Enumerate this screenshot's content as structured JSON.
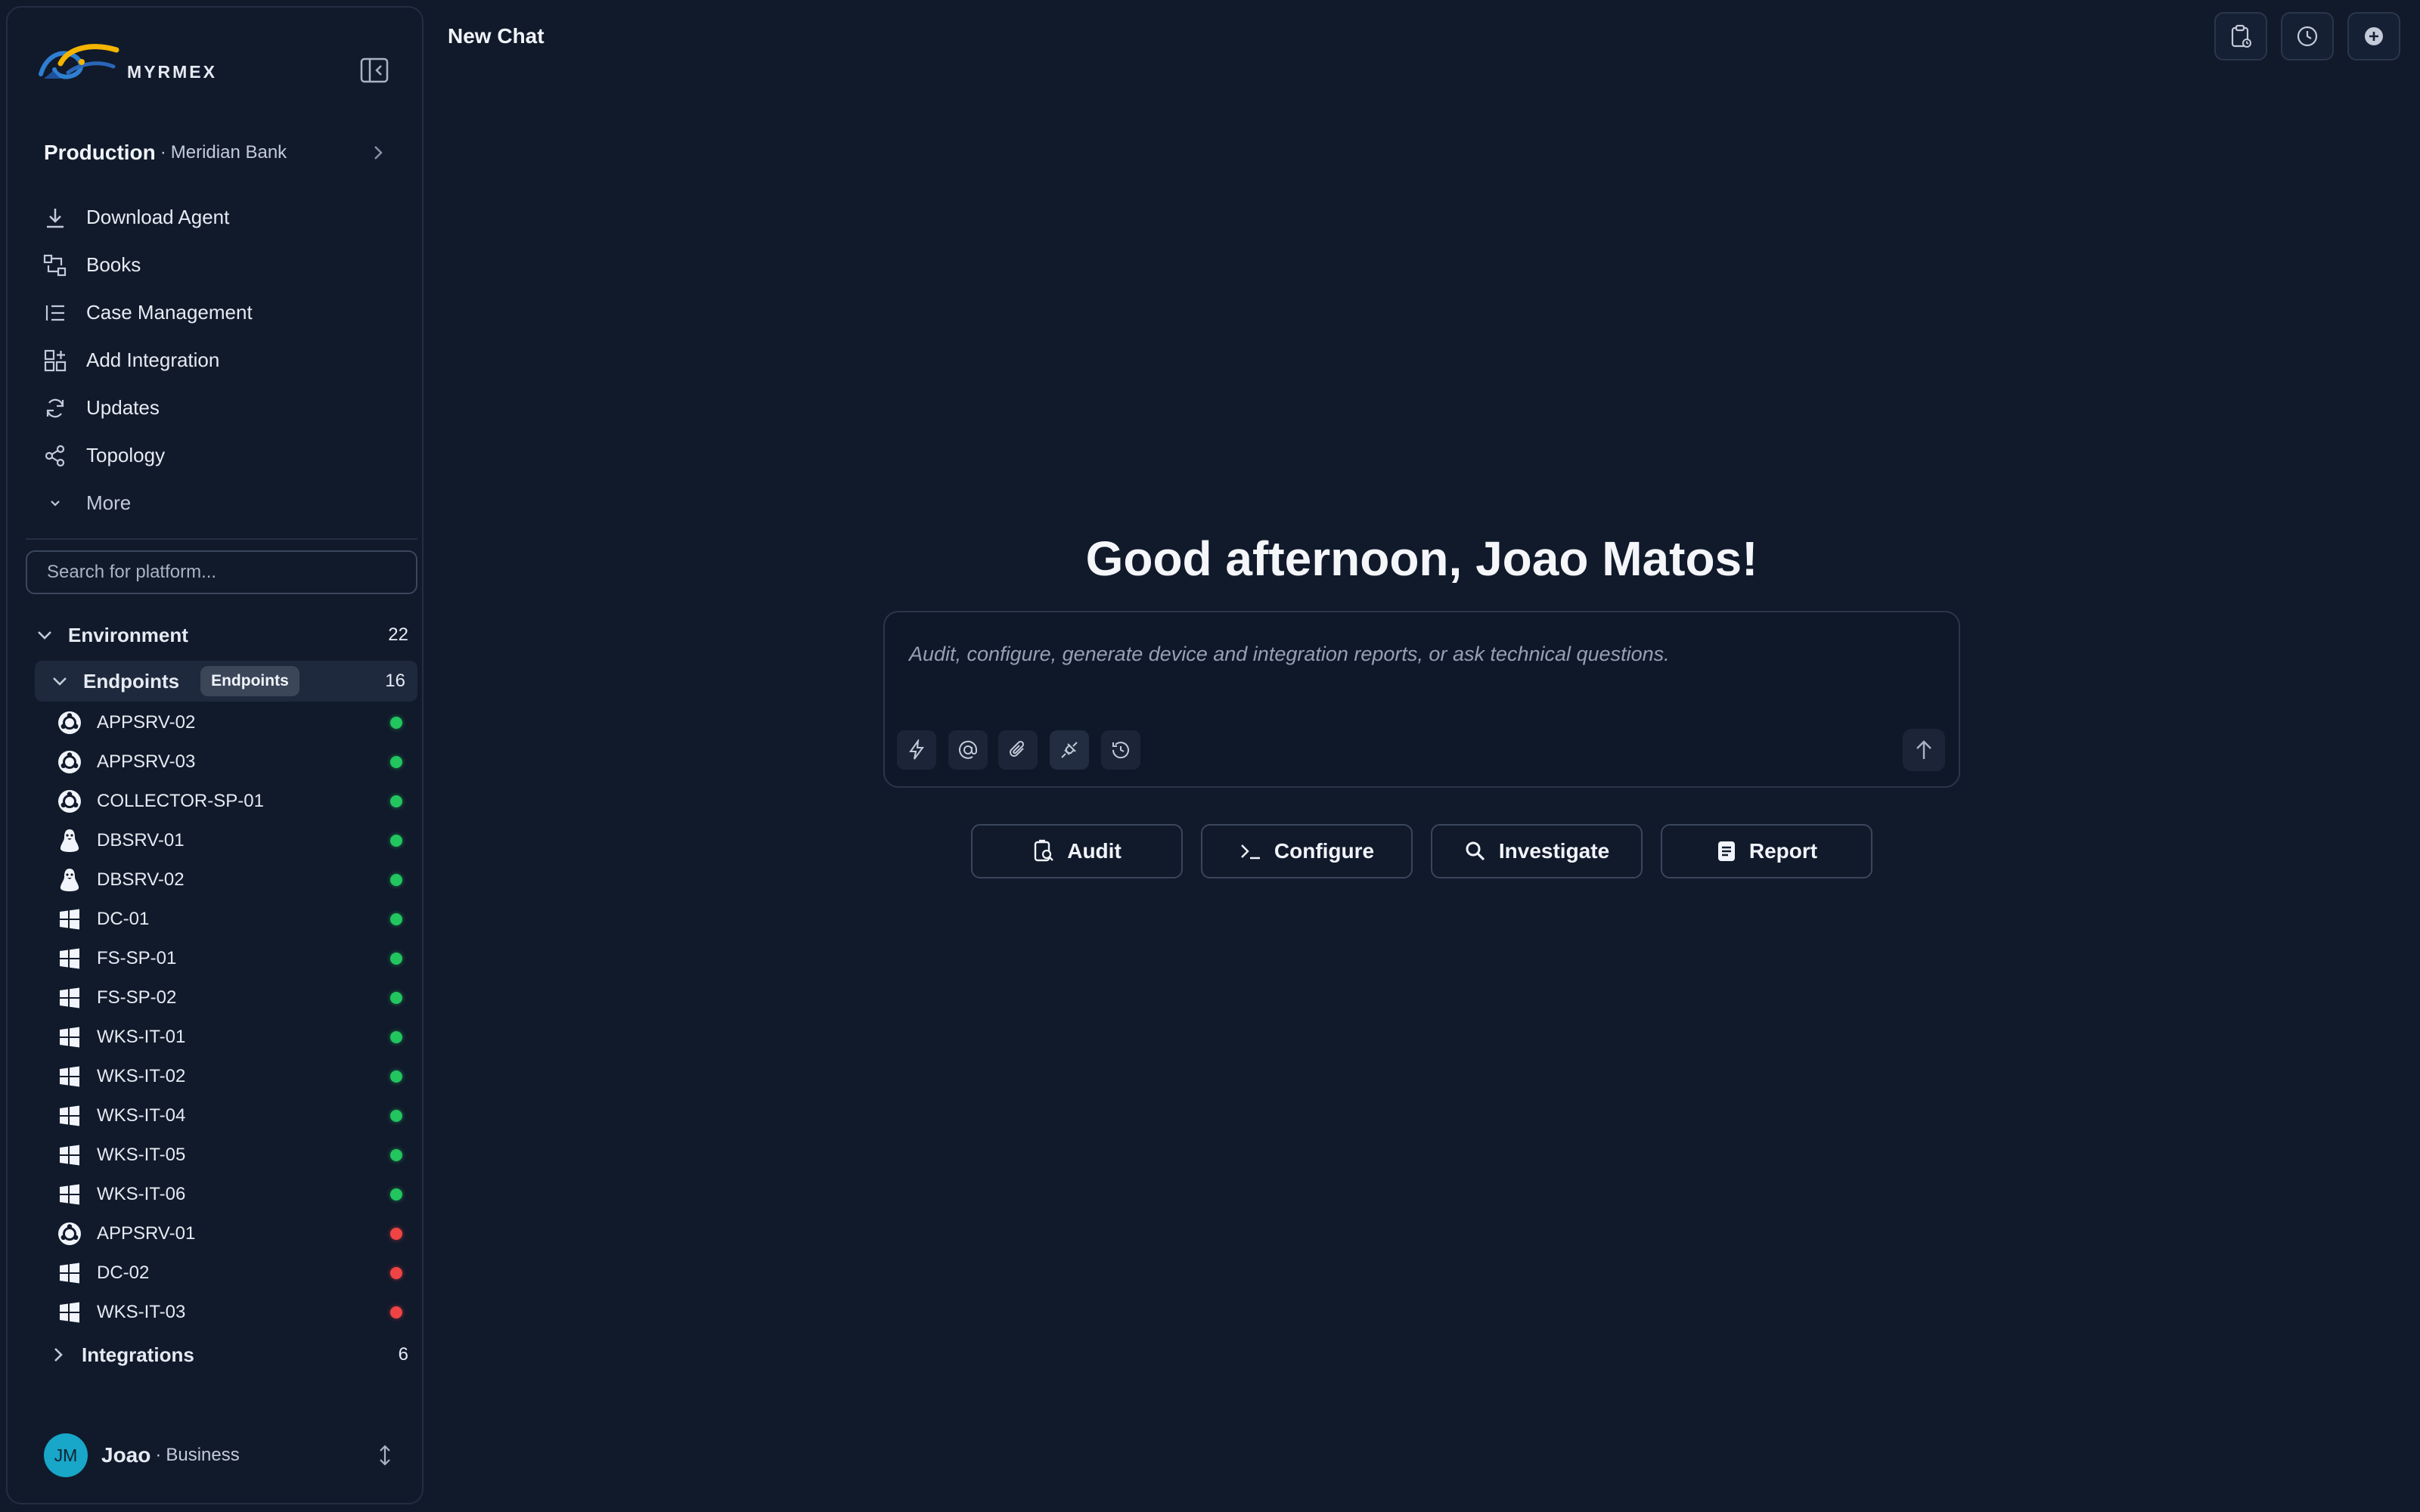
{
  "brand": {
    "name": "MYRMEX"
  },
  "org": {
    "name": "Production",
    "separator": "·",
    "company": "Meridian Bank"
  },
  "nav": {
    "items": [
      {
        "label": "Download Agent",
        "icon": "download-icon"
      },
      {
        "label": "Books",
        "icon": "books-icon"
      },
      {
        "label": "Case Management",
        "icon": "list-icon"
      },
      {
        "label": "Add Integration",
        "icon": "add-integration-icon"
      },
      {
        "label": "Updates",
        "icon": "refresh-icon"
      },
      {
        "label": "Topology",
        "icon": "share-icon"
      }
    ],
    "more_label": "More"
  },
  "search": {
    "placeholder": "Search for platform..."
  },
  "environment": {
    "label": "Environment",
    "count": "22",
    "endpoints": {
      "label": "Endpoints",
      "tooltip": "Endpoints",
      "count": "16",
      "items": [
        {
          "name": "APPSRV-02",
          "os": "ubuntu",
          "status": "online"
        },
        {
          "name": "APPSRV-03",
          "os": "ubuntu",
          "status": "online"
        },
        {
          "name": "COLLECTOR-SP-01",
          "os": "ubuntu",
          "status": "online"
        },
        {
          "name": "DBSRV-01",
          "os": "linux",
          "status": "online"
        },
        {
          "name": "DBSRV-02",
          "os": "linux",
          "status": "online"
        },
        {
          "name": "DC-01",
          "os": "windows",
          "status": "online"
        },
        {
          "name": "FS-SP-01",
          "os": "windows",
          "status": "online"
        },
        {
          "name": "FS-SP-02",
          "os": "windows",
          "status": "online"
        },
        {
          "name": "WKS-IT-01",
          "os": "windows",
          "status": "online"
        },
        {
          "name": "WKS-IT-02",
          "os": "windows",
          "status": "online"
        },
        {
          "name": "WKS-IT-04",
          "os": "windows",
          "status": "online"
        },
        {
          "name": "WKS-IT-05",
          "os": "windows",
          "status": "online"
        },
        {
          "name": "WKS-IT-06",
          "os": "windows",
          "status": "online"
        },
        {
          "name": "APPSRV-01",
          "os": "ubuntu",
          "status": "offline"
        },
        {
          "name": "DC-02",
          "os": "windows",
          "status": "offline"
        },
        {
          "name": "WKS-IT-03",
          "os": "windows",
          "status": "offline"
        }
      ]
    },
    "integrations": {
      "label": "Integrations",
      "count": "6"
    }
  },
  "user": {
    "initials": "JM",
    "name": "Joao",
    "separator": "·",
    "plan": "Business"
  },
  "header": {
    "title": "New Chat"
  },
  "main": {
    "greeting": "Good afternoon, Joao Matos!",
    "composer_placeholder": "Audit, configure, generate device and integration reports, or ask technical questions.",
    "actions": [
      {
        "label": "Audit",
        "icon": "audit-icon"
      },
      {
        "label": "Configure",
        "icon": "terminal-icon"
      },
      {
        "label": "Investigate",
        "icon": "search-icon"
      },
      {
        "label": "Report",
        "icon": "report-icon"
      }
    ]
  },
  "colors": {
    "background": "#111a2b",
    "online": "#22c55e",
    "offline": "#ef4444",
    "avatar": "#18a6c9"
  }
}
